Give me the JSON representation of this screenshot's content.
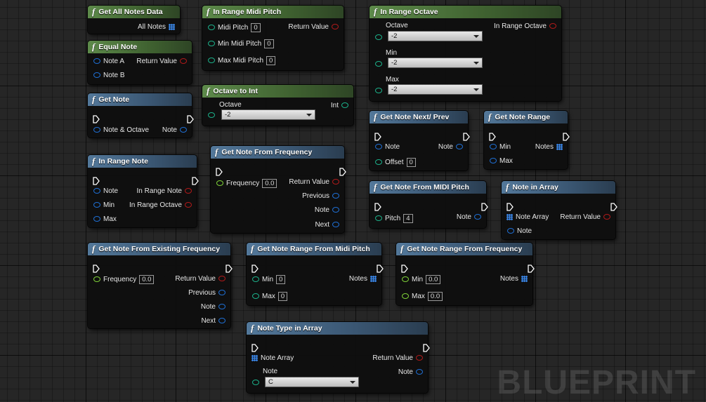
{
  "watermark": "BLUEPRINT",
  "colors": {
    "green_header": "#4e7a3c",
    "blue_header": "#466a8c",
    "pin_blue": "#1f6fd4",
    "pin_teal": "#1cb18a",
    "pin_red": "#b11a1a",
    "pin_green": "#7fd338"
  },
  "nodes": {
    "get_all_notes_data": {
      "title": "Get All Notes Data",
      "out1": "All Notes"
    },
    "equal_note": {
      "title": "Equal Note",
      "in1": "Note A",
      "in2": "Note B",
      "out1": "Return Value"
    },
    "get_note": {
      "title": "Get Note",
      "in1": "Note & Octave",
      "out1": "Note"
    },
    "in_range_note": {
      "title": "In Range Note",
      "in1": "Note",
      "in2": "Min",
      "in3": "Max",
      "out1": "In Range Note",
      "out2": "In Range Octave"
    },
    "get_note_from_existing_frequency": {
      "title": "Get Note From Existing Frequency",
      "in1": "Frequency",
      "in1_value": "0.0",
      "out1": "Return Value",
      "out2": "Previous",
      "out3": "Note",
      "out4": "Next"
    },
    "in_range_midi_pitch": {
      "title": "In Range Midi Pitch",
      "in1": "Midi Pitch",
      "in1_value": "0",
      "in2": "Min Midi Pitch",
      "in2_value": "0",
      "in3": "Max Midi Pitch",
      "in3_value": "0",
      "out1": "Return Value"
    },
    "octave_to_int": {
      "title": "Octave to Int",
      "in1": "Octave",
      "in1_value": "-2",
      "out1": "Int"
    },
    "get_note_from_frequency": {
      "title": "Get Note From Frequency",
      "in1": "Frequency",
      "in1_value": "0.0",
      "out1": "Return Value",
      "out2": "Previous",
      "out3": "Note",
      "out4": "Next"
    },
    "get_note_range_from_midi_pitch": {
      "title": "Get Note Range From Midi Pitch",
      "in1": "Min",
      "in1_value": "0",
      "in2": "Max",
      "in2_value": "0",
      "out1": "Notes"
    },
    "note_type_in_array": {
      "title": "Note Type in Array",
      "in1": "Note Array",
      "in2": "Note",
      "in2_value": "C",
      "out1": "Return Value",
      "out2": "Note"
    },
    "in_range_octave": {
      "title": "In Range Octave",
      "in1": "Octave",
      "in1_value": "-2",
      "in2": "Min",
      "in2_value": "-2",
      "in3": "Max",
      "in3_value": "-2",
      "out1": "In Range Octave"
    },
    "get_note_next_prev": {
      "title": "Get Note Next/ Prev",
      "in1": "Note",
      "in2": "Offset",
      "in2_value": "0",
      "out1": "Note"
    },
    "get_note_range": {
      "title": "Get Note Range",
      "in1": "Min",
      "in2": "Max",
      "out1": "Notes"
    },
    "get_note_from_midi_pitch": {
      "title": "Get Note From MIDI Pitch",
      "in1": "Pitch",
      "in1_value": "4",
      "out1": "Note"
    },
    "note_in_array": {
      "title": "Note in Array",
      "in1": "Note Array",
      "in2": "Note",
      "out1": "Return Value"
    },
    "get_note_range_from_frequency": {
      "title": "Get Note Range From Frequency",
      "in1": "Min",
      "in1_value": "0.0",
      "in2": "Max",
      "in2_value": "0.0",
      "out1": "Notes"
    }
  }
}
